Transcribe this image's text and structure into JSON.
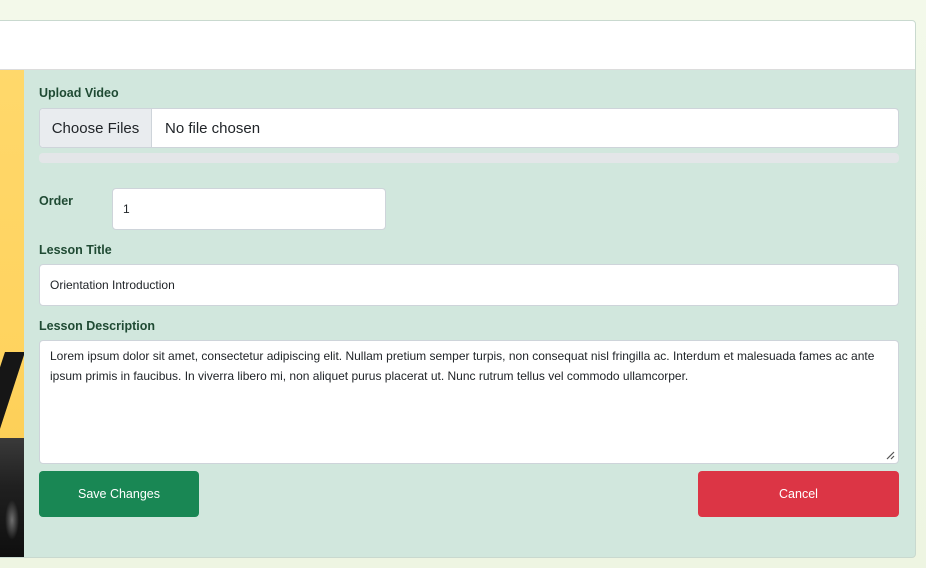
{
  "form": {
    "upload_label": "Upload Video",
    "file_button_label": "Choose Files",
    "file_status": "No file chosen",
    "upload_progress": 0,
    "order_label": "Order",
    "order_value": "1",
    "lesson_title_label": "Lesson Title",
    "lesson_title_value": "Orientation Introduction",
    "lesson_description_label": "Lesson Description",
    "lesson_description_value": "Lorem ipsum dolor sit amet, consectetur adipiscing elit. Nullam pretium semper turpis, non consequat nisl fringilla ac. Interdum et malesuada fames ac ante ipsum primis in faucibus. In viverra libero mi, non aliquet purus placerat ut. Nunc rutrum tellus vel commodo ullamcorper.",
    "save_label": "Save Changes",
    "cancel_label": "Cancel"
  },
  "colors": {
    "panel_bg": "#d1e7dd",
    "save_button": "#198754",
    "cancel_button": "#dc3545",
    "label_text": "#1f4a33"
  },
  "icons": {
    "resize_grip": "resize-grip-icon"
  }
}
